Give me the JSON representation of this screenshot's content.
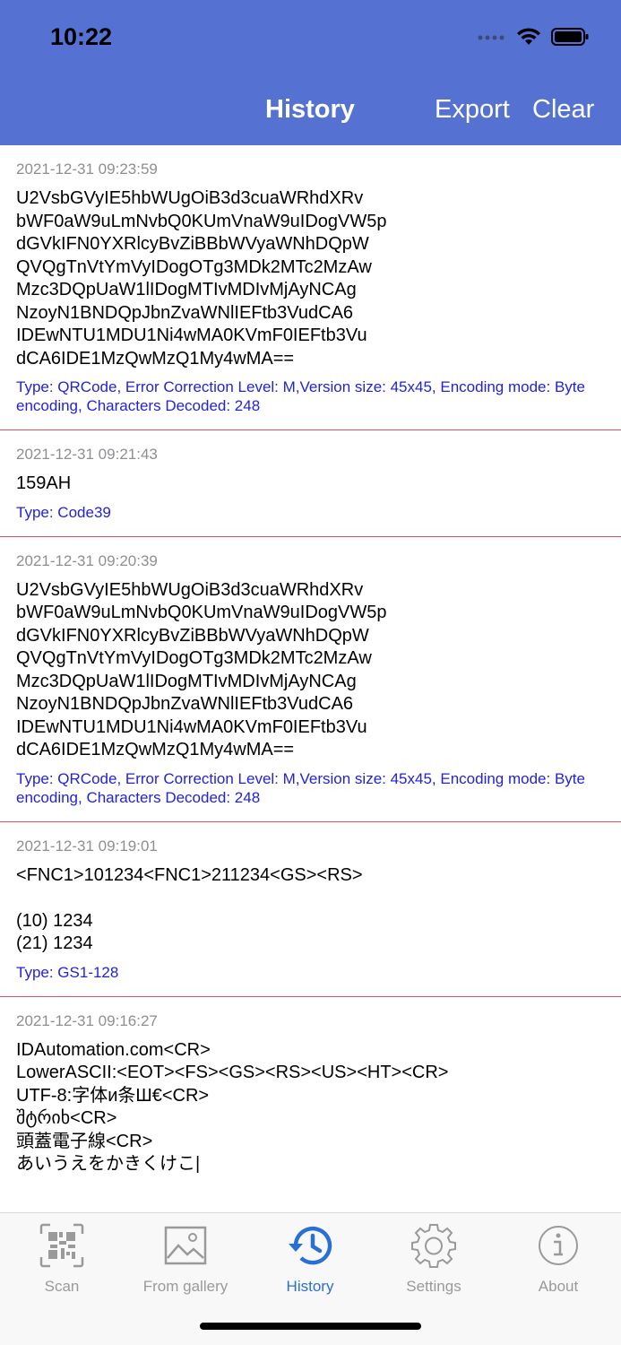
{
  "status_bar": {
    "time": "10:22"
  },
  "nav": {
    "title": "History",
    "export_label": "Export",
    "clear_label": "Clear"
  },
  "entries": [
    {
      "date": "2021-12-31 09:23:59",
      "text": "U2VsbGVyIE5hbWUgOiB3d3cuaWRhdXRv\nbWF0aW9uLmNvbQ0KUmVnaW9uIDogVW5p\ndGVkIFN0YXRlcyBvZiBBbWVyaWNhDQpW\nQVQgTnVtYmVyIDogOTg3MDk2MTc2MzAw\nMzc3DQpUaW1lIDogMTIvMDIvMjAyNCAg\nNzoyN1BNDQpJbnZvaWNlIEFtb3VudCA6\nIDEwNTU1MDU1Ni4wMA0KVmF0IEFtb3Vu\ndCA6IDE1MzQwMzQ1My4wMA==",
      "type": "Type: QRCode, Error Correction Level: M,Version size: 45x45, Encoding mode: Byte encoding, Characters Decoded: 248"
    },
    {
      "date": "2021-12-31 09:21:43",
      "text": "159AH",
      "type": "Type: Code39"
    },
    {
      "date": "2021-12-31 09:20:39",
      "text": "U2VsbGVyIE5hbWUgOiB3d3cuaWRhdXRv\nbWF0aW9uLmNvbQ0KUmVnaW9uIDogVW5p\ndGVkIFN0YXRlcyBvZiBBbWVyaWNhDQpW\nQVQgTnVtYmVyIDogOTg3MDk2MTc2MzAw\nMzc3DQpUaW1lIDogMTIvMDIvMjAyNCAg\nNzoyN1BNDQpJbnZvaWNlIEFtb3VudCA6\nIDEwNTU1MDU1Ni4wMA0KVmF0IEFtb3Vu\ndCA6IDE1MzQwMzQ1My4wMA==",
      "type": "Type: QRCode, Error Correction Level: M,Version size: 45x45, Encoding mode: Byte encoding, Characters Decoded: 248"
    },
    {
      "date": "2021-12-31 09:19:01",
      "text": "<FNC1>101234<FNC1>211234<GS><RS>\n\n(10) 1234\n(21) 1234",
      "type": "Type: GS1-128"
    },
    {
      "date": "2021-12-31 09:16:27",
      "text": "IDAutomation.com<CR>\nLowerASCII:<EOT><FS><GS><RS><US><HT><CR>\nUTF-8:字体и条Ш€<CR>\nშტრიხ<CR>\n頭蓋電子線<CR>\nあいうえをかきくけこ|",
      "type": ""
    }
  ],
  "tabs": [
    {
      "label": "Scan",
      "icon": "qr-code-icon",
      "active": false
    },
    {
      "label": "From gallery",
      "icon": "image-icon",
      "active": false
    },
    {
      "label": "History",
      "icon": "history-icon",
      "active": true
    },
    {
      "label": "Settings",
      "icon": "gear-icon",
      "active": false
    },
    {
      "label": "About",
      "icon": "info-icon",
      "active": false
    }
  ],
  "colors": {
    "header": "#5572d3",
    "separator": "#e0515a",
    "type_text": "#2222dd",
    "tab_active": "#2a6fd6"
  }
}
